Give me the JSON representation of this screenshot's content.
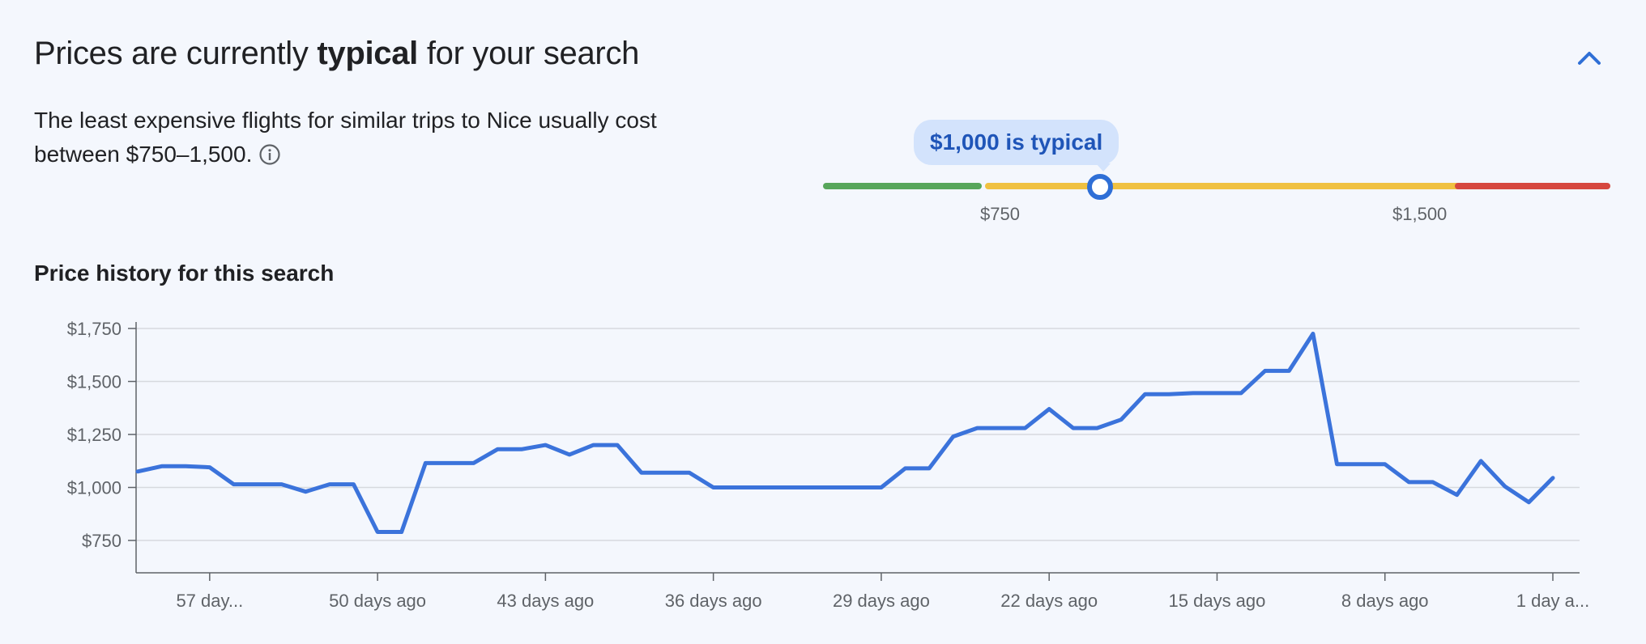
{
  "header": {
    "title_prefix": "Prices are currently ",
    "title_emphasis": "typical",
    "title_suffix": " for your search",
    "collapse_icon": "chevron-up-icon"
  },
  "summary": {
    "description": "The least expensive flights for similar trips to Nice usually cost between $750–1,500.",
    "info_icon": "info-icon"
  },
  "price_gauge": {
    "bubble_text": "$1,000 is typical",
    "low_label": "$750",
    "high_label": "$1,500",
    "current_value": 1000,
    "colors": {
      "low": "#57a65b",
      "typical": "#f0c141",
      "high": "#d6473f",
      "marker": "#2f6fd6"
    }
  },
  "history": {
    "title": "Price history for this search"
  },
  "chart_data": {
    "type": "line",
    "title": "Price history for this search",
    "xlabel": "",
    "ylabel": "",
    "ylim": [
      590,
      1770
    ],
    "yticks": [
      1750,
      1500,
      1250,
      1000,
      750
    ],
    "ytick_labels": [
      "$1,750",
      "$1,500",
      "$1,250",
      "$1,000",
      "$750"
    ],
    "xlim": [
      60,
      1
    ],
    "xticks": [
      57,
      50,
      43,
      36,
      29,
      22,
      15,
      8,
      1
    ],
    "xtick_labels": [
      "57 day...",
      "50 days ago",
      "43 days ago",
      "36 days ago",
      "29 days ago",
      "22 days ago",
      "15 days ago",
      "8 days ago",
      "1 day a..."
    ],
    "grid": true,
    "line_color": "#3b73db",
    "series": [
      {
        "x": [
          60,
          59,
          58,
          57,
          56,
          55,
          54,
          53,
          52,
          51,
          50,
          49,
          48,
          47,
          46,
          45,
          44,
          43,
          42,
          41,
          40,
          39,
          38,
          37,
          36,
          35,
          34,
          33,
          32,
          31,
          30,
          29,
          28,
          27,
          26,
          25,
          24,
          23,
          22,
          21,
          20,
          19,
          18,
          17,
          16,
          15,
          14,
          13,
          12,
          11,
          10,
          9,
          8,
          7,
          6,
          5,
          4,
          3,
          2,
          1
        ],
        "values": [
          1075,
          1100,
          1100,
          1095,
          1015,
          1015,
          1015,
          980,
          1015,
          1015,
          790,
          790,
          1115,
          1115,
          1115,
          1180,
          1180,
          1200,
          1155,
          1200,
          1200,
          1070,
          1070,
          1070,
          1000,
          1000,
          1000,
          1000,
          1000,
          1000,
          1000,
          1000,
          1090,
          1090,
          1240,
          1280,
          1280,
          1280,
          1370,
          1280,
          1280,
          1320,
          1440,
          1440,
          1445,
          1445,
          1445,
          1550,
          1550,
          1725,
          1110,
          1110,
          1110,
          1025,
          1025,
          965,
          1125,
          1005,
          930,
          1045
        ]
      }
    ]
  }
}
